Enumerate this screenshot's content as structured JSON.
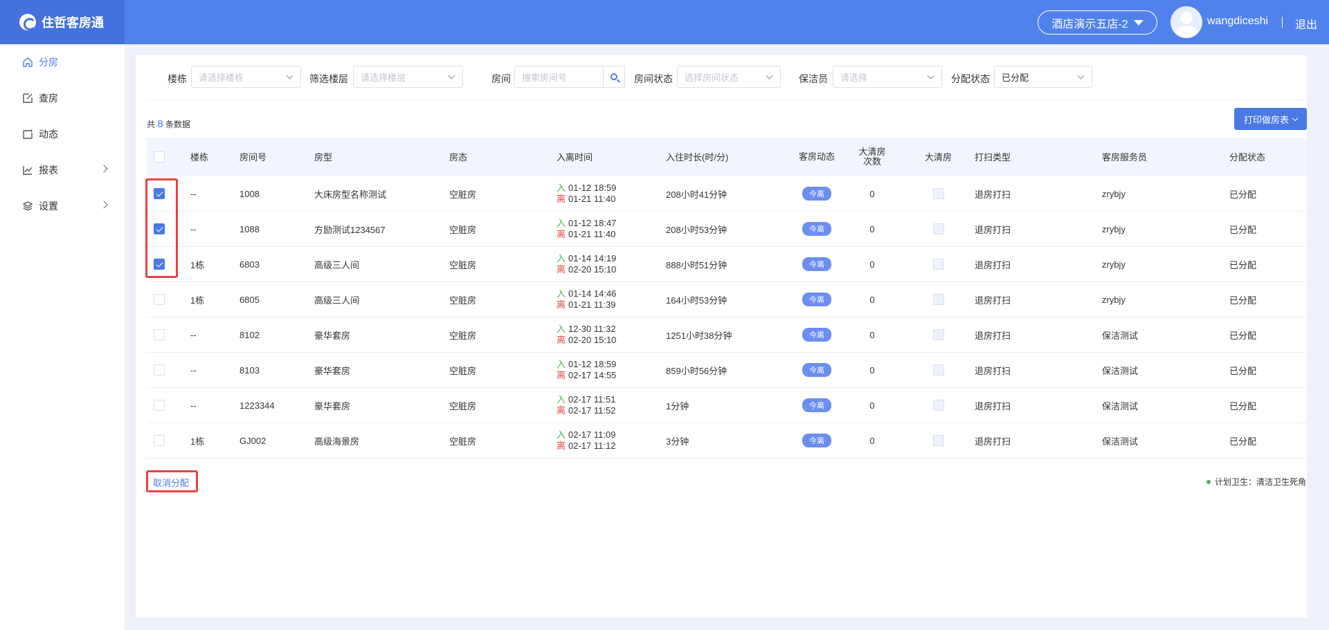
{
  "header": {
    "logo_text": "住哲客房通",
    "hotel": "酒店演示五店-2",
    "username": "wangdiceshi",
    "logout": "退出"
  },
  "sidebar": {
    "items": [
      {
        "label": "分房",
        "icon": "home-icon",
        "active": true
      },
      {
        "label": "查房",
        "icon": "edit-icon"
      },
      {
        "label": "动态",
        "icon": "activity-icon"
      },
      {
        "label": "报表",
        "icon": "chart-icon",
        "has_arrow": true
      },
      {
        "label": "设置",
        "icon": "layers-icon",
        "has_arrow": true
      }
    ]
  },
  "filters": {
    "building": {
      "label": "楼栋",
      "placeholder": "请选择楼栋"
    },
    "floor": {
      "label": "筛选楼层",
      "placeholder": "请选择楼层"
    },
    "room": {
      "label": "房间",
      "placeholder": "搜索房间号"
    },
    "room_status": {
      "label": "房间状态",
      "placeholder": "选择房间状态"
    },
    "cleaner": {
      "label": "保洁员",
      "placeholder": "请选择"
    },
    "assign_status": {
      "label": "分配状态",
      "value": "已分配"
    }
  },
  "summary": {
    "prefix": "共",
    "count": "8",
    "suffix": "条数据"
  },
  "print_button": "打印做房表",
  "table": {
    "headers": {
      "building": "楼栋",
      "room_no": "房间号",
      "room_type": "房型",
      "room_state": "房态",
      "checkin_time": "入离时间",
      "stay_duration": "入住时长(时/分)",
      "room_dynamic": "客房动态",
      "deep_clean_count": "大清房次数",
      "deep_clean": "大清房",
      "clean_type": "打扫类型",
      "attendant": "客房服务员",
      "assign_status": "分配状态"
    },
    "in_label": "入",
    "out_label": "离",
    "rows": [
      {
        "checked": true,
        "building": "--",
        "room_no": "1008",
        "room_type": "大床房型名称测试",
        "room_state": "空脏房",
        "in_time": "01-12 18:59",
        "out_time": "01-21 11:40",
        "duration": "208小时41分钟",
        "dynamic": "今离",
        "deep_count": "0",
        "clean_type": "退房打扫",
        "attendant": "zrybjy",
        "assign": "已分配"
      },
      {
        "checked": true,
        "building": "--",
        "room_no": "1088",
        "room_type": "方励测试1234567",
        "room_state": "空脏房",
        "in_time": "01-12 18:47",
        "out_time": "01-21 11:40",
        "duration": "208小时53分钟",
        "dynamic": "今离",
        "deep_count": "0",
        "clean_type": "退房打扫",
        "attendant": "zrybjy",
        "assign": "已分配"
      },
      {
        "checked": true,
        "building": "1栋",
        "room_no": "6803",
        "room_type": "高级三人间",
        "room_state": "空脏房",
        "in_time": "01-14 14:19",
        "out_time": "02-20 15:10",
        "duration": "888小时51分钟",
        "dynamic": "今离",
        "deep_count": "0",
        "clean_type": "退房打扫",
        "attendant": "zrybjy",
        "assign": "已分配"
      },
      {
        "checked": false,
        "building": "1栋",
        "room_no": "6805",
        "room_type": "高级三人间",
        "room_state": "空脏房",
        "in_time": "01-14 14:46",
        "out_time": "01-21 11:39",
        "duration": "164小时53分钟",
        "dynamic": "今离",
        "deep_count": "0",
        "clean_type": "退房打扫",
        "attendant": "zrybjy",
        "assign": "已分配"
      },
      {
        "checked": false,
        "building": "--",
        "room_no": "8102",
        "room_type": "豪华套房",
        "room_state": "空脏房",
        "in_time": "12-30 11:32",
        "out_time": "02-20 15:10",
        "duration": "1251小时38分钟",
        "dynamic": "今离",
        "deep_count": "0",
        "clean_type": "退房打扫",
        "attendant": "保洁测试",
        "assign": "已分配"
      },
      {
        "checked": false,
        "building": "--",
        "room_no": "8103",
        "room_type": "豪华套房",
        "room_state": "空脏房",
        "in_time": "01-12 18:59",
        "out_time": "02-17 14:55",
        "duration": "859小时56分钟",
        "dynamic": "今离",
        "deep_count": "0",
        "clean_type": "退房打扫",
        "attendant": "保洁测试",
        "assign": "已分配"
      },
      {
        "checked": false,
        "building": "--",
        "room_no": "1223344",
        "room_type": "豪华套房",
        "room_state": "空脏房",
        "in_time": "02-17 11:51",
        "out_time": "02-17 11:52",
        "duration": "1分钟",
        "dynamic": "今离",
        "deep_count": "0",
        "clean_type": "退房打扫",
        "attendant": "保洁测试",
        "assign": "已分配"
      },
      {
        "checked": false,
        "building": "1栋",
        "room_no": "GJ002",
        "room_type": "高级海景房",
        "room_state": "空脏房",
        "in_time": "02-17 11:09",
        "out_time": "02-17 11:12",
        "duration": "3分钟",
        "dynamic": "今离",
        "deep_count": "0",
        "clean_type": "退房打扫",
        "attendant": "保洁测试",
        "assign": "已分配"
      }
    ]
  },
  "cancel_assign": "取消分配",
  "legend": "计划卫生：清洁卫生死角",
  "colors": {
    "primary": "#4a79e6",
    "header": "#5182ec",
    "highlight": "#e84040",
    "in": "#4caf50",
    "out": "#e64a4a"
  }
}
